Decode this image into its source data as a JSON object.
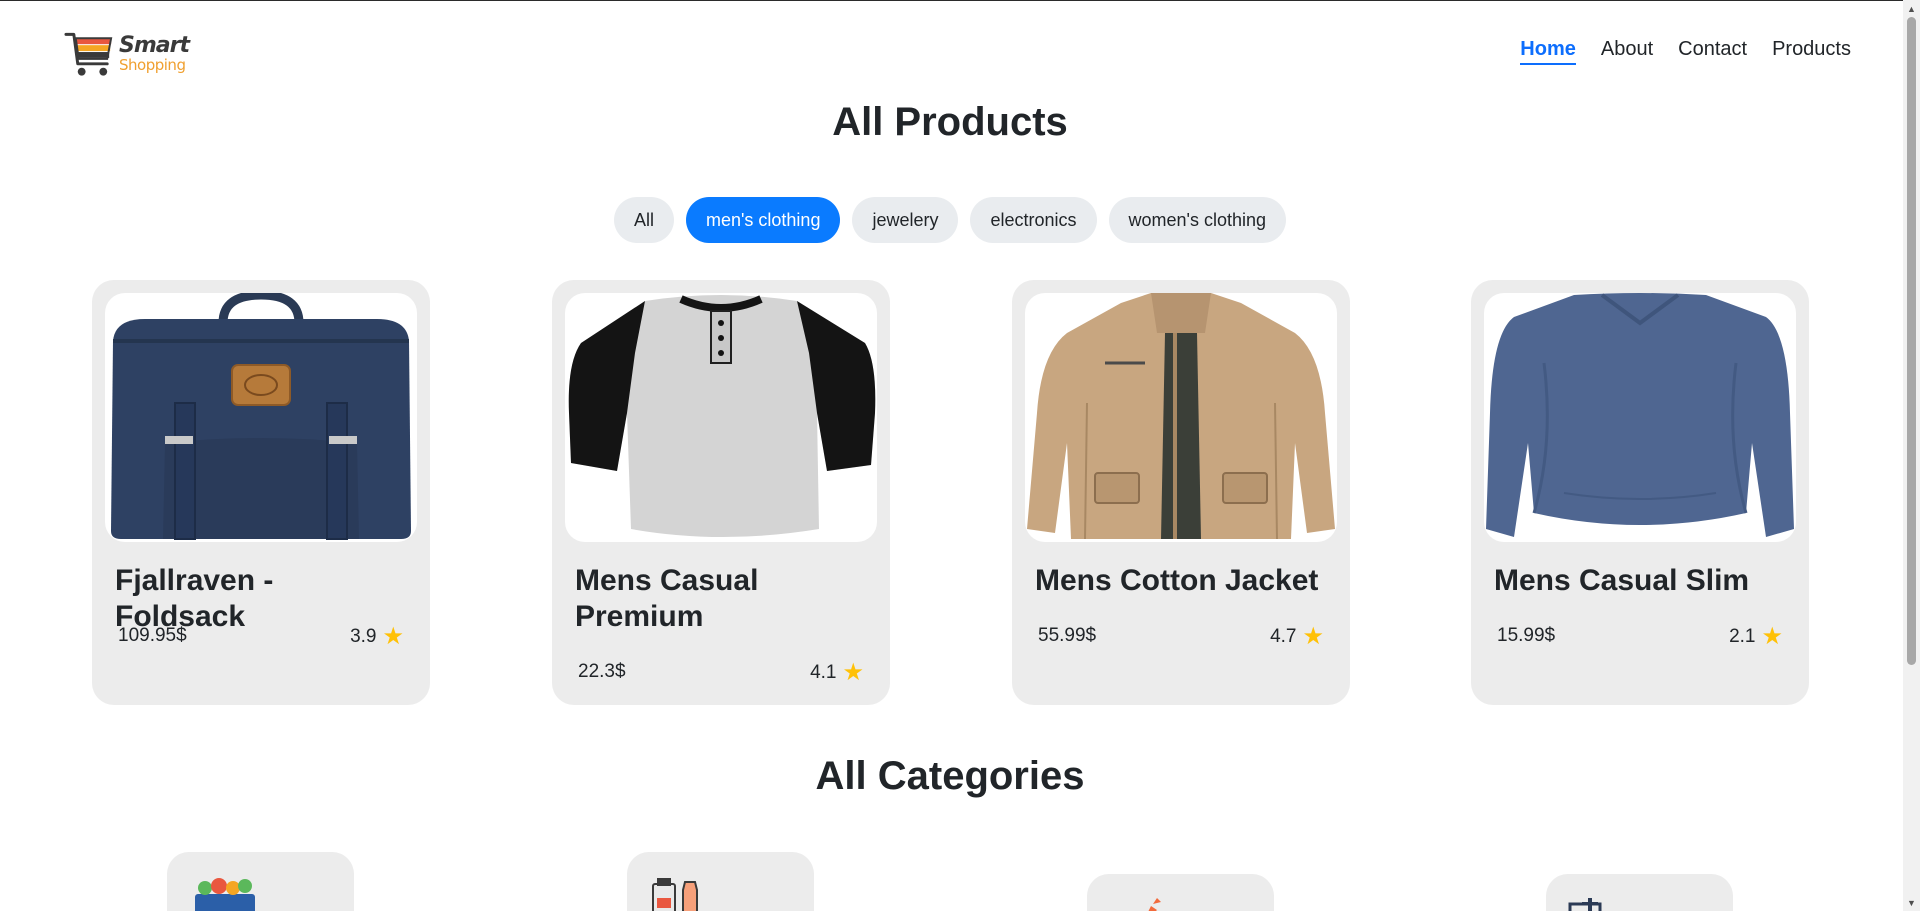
{
  "header": {
    "logo": {
      "title": "Smart",
      "subtitle": "Shopping"
    },
    "nav": [
      {
        "label": "Home",
        "active": true
      },
      {
        "label": "About",
        "active": false
      },
      {
        "label": "Contact",
        "active": false
      },
      {
        "label": "Products",
        "active": false
      }
    ]
  },
  "products_section": {
    "title": "All Products",
    "filters": [
      {
        "label": "All",
        "active": false
      },
      {
        "label": "men's clothing",
        "active": true
      },
      {
        "label": "jewelery",
        "active": false
      },
      {
        "label": "electronics",
        "active": false
      },
      {
        "label": "women's clothing",
        "active": false
      }
    ],
    "products": [
      {
        "name": "Fjallraven - Foldsack",
        "price": "109.95$",
        "rating": "3.9",
        "image_icon": "backpack-image"
      },
      {
        "name": "Mens Casual Premium",
        "price": "22.3$",
        "rating": "4.1",
        "image_icon": "raglan-shirt-image"
      },
      {
        "name": "Mens Cotton Jacket",
        "price": "55.99$",
        "rating": "4.7",
        "image_icon": "jacket-image"
      },
      {
        "name": "Mens Casual Slim",
        "price": "15.99$",
        "rating": "2.1",
        "image_icon": "long-sleeve-shirt-image"
      }
    ]
  },
  "categories_section": {
    "title": "All Categories",
    "categories": [
      {
        "icon": "vegetables-basket-icon"
      },
      {
        "icon": "bottles-icon"
      },
      {
        "icon": "carrot-icon"
      },
      {
        "icon": "appliance-icon"
      }
    ]
  },
  "colors": {
    "accent": "#0a7bff",
    "card_bg": "#ececec",
    "star": "#ffc107",
    "logo_sub": "#f0a030"
  }
}
